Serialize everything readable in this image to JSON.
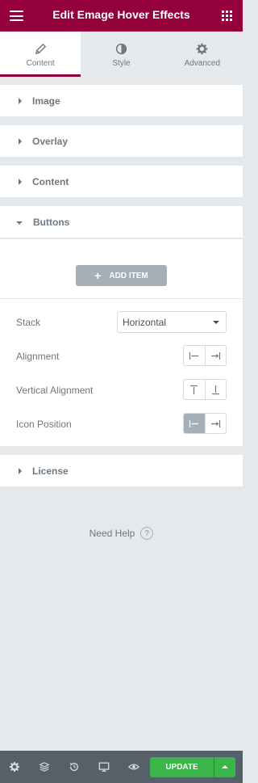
{
  "header": {
    "title": "Edit Emage Hover Effects",
    "menu_icon": "hamburger-icon",
    "apps_icon": "grid-icon"
  },
  "tabs": [
    {
      "label": "Content",
      "icon": "pencil-icon",
      "active": true
    },
    {
      "label": "Style",
      "icon": "half-circle-icon",
      "active": false
    },
    {
      "label": "Advanced",
      "icon": "gear-icon",
      "active": false
    }
  ],
  "sections": {
    "image": "Image",
    "overlay": "Overlay",
    "content": "Content",
    "buttons": "Buttons",
    "license": "License"
  },
  "buttons_panel": {
    "add_item": "ADD ITEM",
    "stack_label": "Stack",
    "stack_value": "Horizontal",
    "alignment_label": "Alignment",
    "vertical_alignment_label": "Vertical Alignment",
    "icon_position_label": "Icon Position"
  },
  "help": {
    "label": "Need Help",
    "icon": "question-icon"
  },
  "footer": {
    "update_label": "UPDATE"
  },
  "colors": {
    "brand": "#93003c",
    "update": "#39b54a",
    "footer": "#556068",
    "panel_bg": "#e6e9ec"
  }
}
